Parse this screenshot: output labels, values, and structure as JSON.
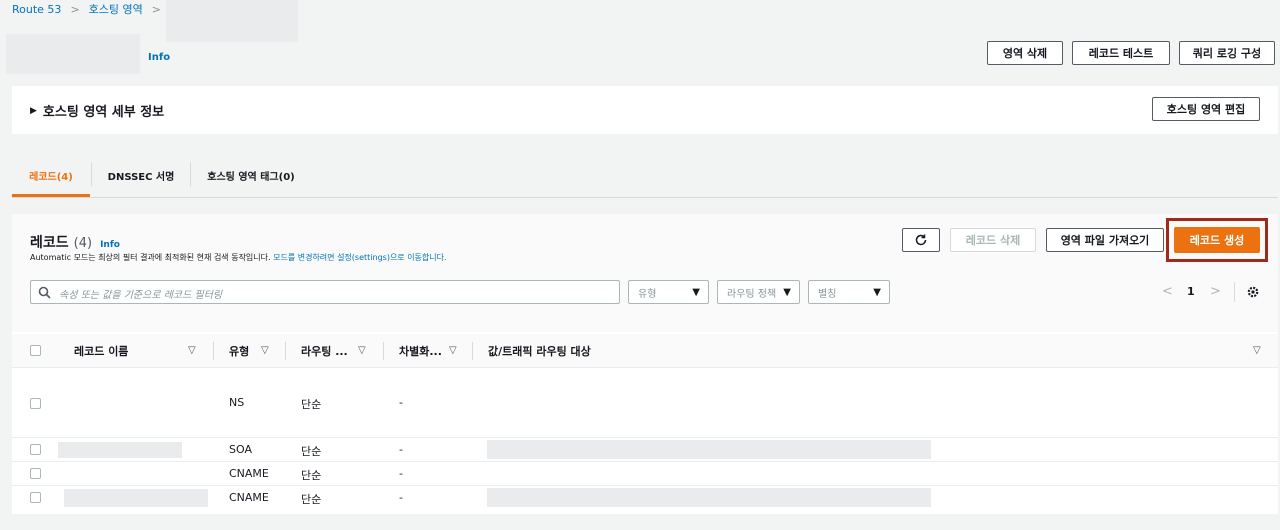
{
  "breadcrumb": {
    "items": [
      "Route 53",
      "호스팅 영역"
    ],
    "separator": ">"
  },
  "header": {
    "info_label": "Info"
  },
  "top_buttons": {
    "delete_zone": "영역 삭제",
    "test_record": "레코드 테스트",
    "query_logging": "쿼리 로깅 구성"
  },
  "details_panel": {
    "toggle_icon": "▶",
    "title": "호스팅 영역 세부 정보",
    "edit_button": "호스팅 영역 편집"
  },
  "tabs": [
    {
      "label": "레코드(4)"
    },
    {
      "label": "DNSSEC 서명"
    },
    {
      "label": "호스팅 영역 태그(0)"
    }
  ],
  "records": {
    "title": "레코드",
    "count": "(4)",
    "info_label": "Info",
    "description": "Automatic 모드는 최상의 필터 결과에 최적화된 현재 검색 동작입니다.",
    "description_link": "모드를 변경하려면 설정(settings)으로 이동합니다.",
    "buttons": {
      "delete": "레코드 삭제",
      "import": "영역 파일 가져오기",
      "create": "레코드 생성"
    },
    "search_placeholder": "속성 또는 값을 기준으로 레코드 필터링",
    "filters": {
      "type": "유형",
      "routing_policy": "라우팅 정책",
      "alias": "별칭"
    },
    "pagination": {
      "prev": "<",
      "page": "1",
      "next": ">"
    },
    "columns": [
      "레코드 이름",
      "유형",
      "라우팅 ...",
      "차별화...",
      "값/트래픽 라우팅 대상"
    ],
    "rows": [
      {
        "type": "NS",
        "routing": "단순",
        "diff": "-"
      },
      {
        "type": "SOA",
        "routing": "단순",
        "diff": "-"
      },
      {
        "type": "CNAME",
        "routing": "단순",
        "diff": "-"
      },
      {
        "type": "CNAME",
        "routing": "단순",
        "diff": "-"
      }
    ]
  },
  "colors": {
    "accent": "#ec7211",
    "link": "#0073bb",
    "highlight_border": "#a0291b"
  }
}
